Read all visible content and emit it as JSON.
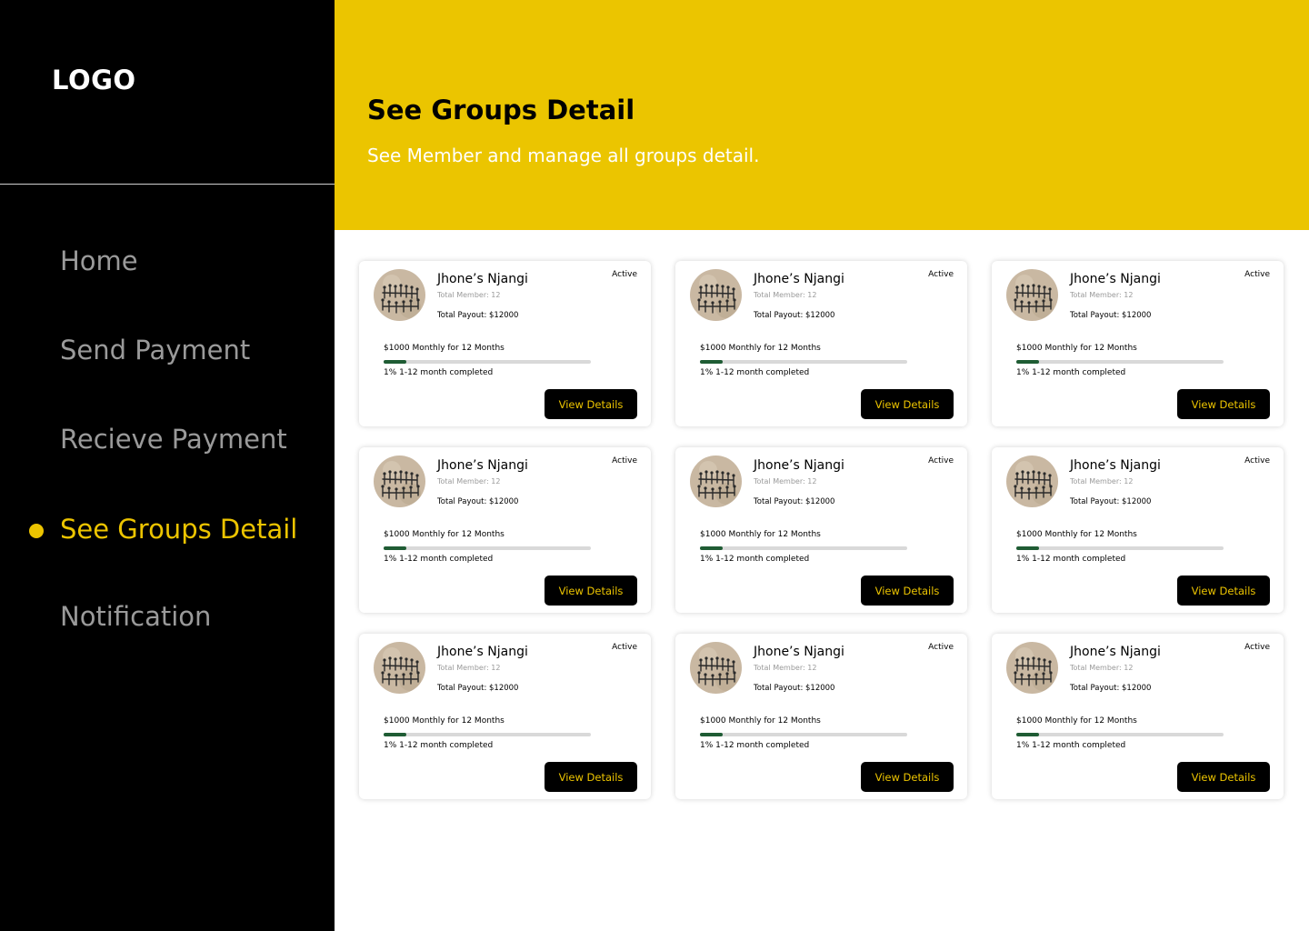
{
  "sidebar": {
    "logo": "LOGO",
    "nav": [
      {
        "label": "Home"
      },
      {
        "label": "Send Payment"
      },
      {
        "label": "Recieve Payment"
      },
      {
        "label": "See Groups Detail",
        "active": true
      },
      {
        "label": "Notification"
      }
    ]
  },
  "header": {
    "title": "See Groups Detail",
    "subtitle": "See Member and manage all groups detail."
  },
  "colors": {
    "accent": "#ebc500",
    "sidebar_bg": "#000000",
    "progress": "#1f5c34"
  },
  "groups": [
    {
      "name": "Jhone’s Njangi",
      "members": "Total Member: 12",
      "payout": "Total Payout: $12000",
      "status": "Active",
      "plan": "$1000 Monthly for 12 Months",
      "progress_text": "1% 1-12 month completed",
      "progress_percent": 11,
      "button": "View Details",
      "avatar_icon": "group-photo-icon"
    },
    {
      "name": "Jhone’s Njangi",
      "members": "Total Member: 12",
      "payout": "Total Payout: $12000",
      "status": "Active",
      "plan": "$1000 Monthly for 12 Months",
      "progress_text": "1% 1-12 month completed",
      "progress_percent": 11,
      "button": "View Details",
      "avatar_icon": "group-photo-icon"
    },
    {
      "name": "Jhone’s Njangi",
      "members": "Total Member: 12",
      "payout": "Total Payout: $12000",
      "status": "Active",
      "plan": "$1000 Monthly for 12 Months",
      "progress_text": "1% 1-12 month completed",
      "progress_percent": 11,
      "button": "View Details",
      "avatar_icon": "group-photo-icon"
    },
    {
      "name": "Jhone’s Njangi",
      "members": "Total Member: 12",
      "payout": "Total Payout: $12000",
      "status": "Active",
      "plan": "$1000 Monthly for 12 Months",
      "progress_text": "1% 1-12 month completed",
      "progress_percent": 11,
      "button": "View Details",
      "avatar_icon": "group-photo-icon"
    },
    {
      "name": "Jhone’s Njangi",
      "members": "Total Member: 12",
      "payout": "Total Payout: $12000",
      "status": "Active",
      "plan": "$1000 Monthly for 12 Months",
      "progress_text": "1% 1-12 month completed",
      "progress_percent": 11,
      "button": "View Details",
      "avatar_icon": "group-photo-icon"
    },
    {
      "name": "Jhone’s Njangi",
      "members": "Total Member: 12",
      "payout": "Total Payout: $12000",
      "status": "Active",
      "plan": "$1000 Monthly for 12 Months",
      "progress_text": "1% 1-12 month completed",
      "progress_percent": 11,
      "button": "View Details",
      "avatar_icon": "group-photo-icon"
    },
    {
      "name": "Jhone’s Njangi",
      "members": "Total Member: 12",
      "payout": "Total Payout: $12000",
      "status": "Active",
      "plan": "$1000 Monthly for 12 Months",
      "progress_text": "1% 1-12 month completed",
      "progress_percent": 11,
      "button": "View Details",
      "avatar_icon": "group-photo-icon"
    },
    {
      "name": "Jhone’s Njangi",
      "members": "Total Member: 12",
      "payout": "Total Payout: $12000",
      "status": "Active",
      "plan": "$1000 Monthly for 12 Months",
      "progress_text": "1% 1-12 month completed",
      "progress_percent": 11,
      "button": "View Details",
      "avatar_icon": "group-photo-icon"
    },
    {
      "name": "Jhone’s Njangi",
      "members": "Total Member: 12",
      "payout": "Total Payout: $12000",
      "status": "Active",
      "plan": "$1000 Monthly for 12 Months",
      "progress_text": "1% 1-12 month completed",
      "progress_percent": 11,
      "button": "View Details",
      "avatar_icon": "group-photo-icon"
    }
  ]
}
